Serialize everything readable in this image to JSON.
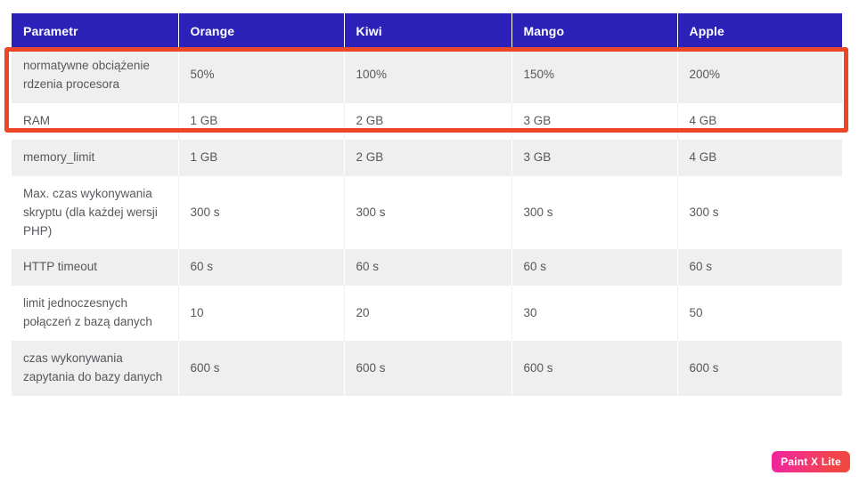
{
  "table": {
    "headers": [
      "Parametr",
      "Orange",
      "Kiwi",
      "Mango",
      "Apple"
    ],
    "rows": [
      {
        "param": "normatywne obciążenie rdzenia procesora",
        "orange": "50%",
        "kiwi": "100%",
        "mango": "150%",
        "apple": "200%"
      },
      {
        "param": "RAM",
        "orange": "1 GB",
        "kiwi": "2 GB",
        "mango": "3 GB",
        "apple": "4 GB"
      },
      {
        "param": "memory_limit",
        "orange": "1 GB",
        "kiwi": "2 GB",
        "mango": "3 GB",
        "apple": "4 GB"
      },
      {
        "param": "Max. czas wykonywania skryptu (dla każdej wersji PHP)",
        "orange": "300 s",
        "kiwi": "300 s",
        "mango": "300 s",
        "apple": "300 s"
      },
      {
        "param": "HTTP timeout",
        "orange": "60 s",
        "kiwi": "60 s",
        "mango": "60 s",
        "apple": "60 s"
      },
      {
        "param": "limit jednoczesnych połączeń z bazą danych",
        "orange": "10",
        "kiwi": "20",
        "mango": "30",
        "apple": "50"
      },
      {
        "param": "czas wykonywania zapytania do bazy danych",
        "orange": "600 s",
        "kiwi": "600 s",
        "mango": "600 s",
        "apple": "600 s"
      }
    ]
  },
  "annotation": {
    "name": "highlight-rectangle",
    "color": "#ED4527",
    "target_row": "normatywne obciążenie rdzenia procesora"
  },
  "watermark": {
    "label": "Paint X Lite",
    "gradient_start": "#F0259C",
    "gradient_end": "#F04A3C"
  },
  "colors": {
    "header_background": "#2B21B8",
    "header_text": "#FFFFFF",
    "row_stripe": "#EFEFEF",
    "row_plain": "#FFFFFF",
    "body_text": "#55585C"
  }
}
